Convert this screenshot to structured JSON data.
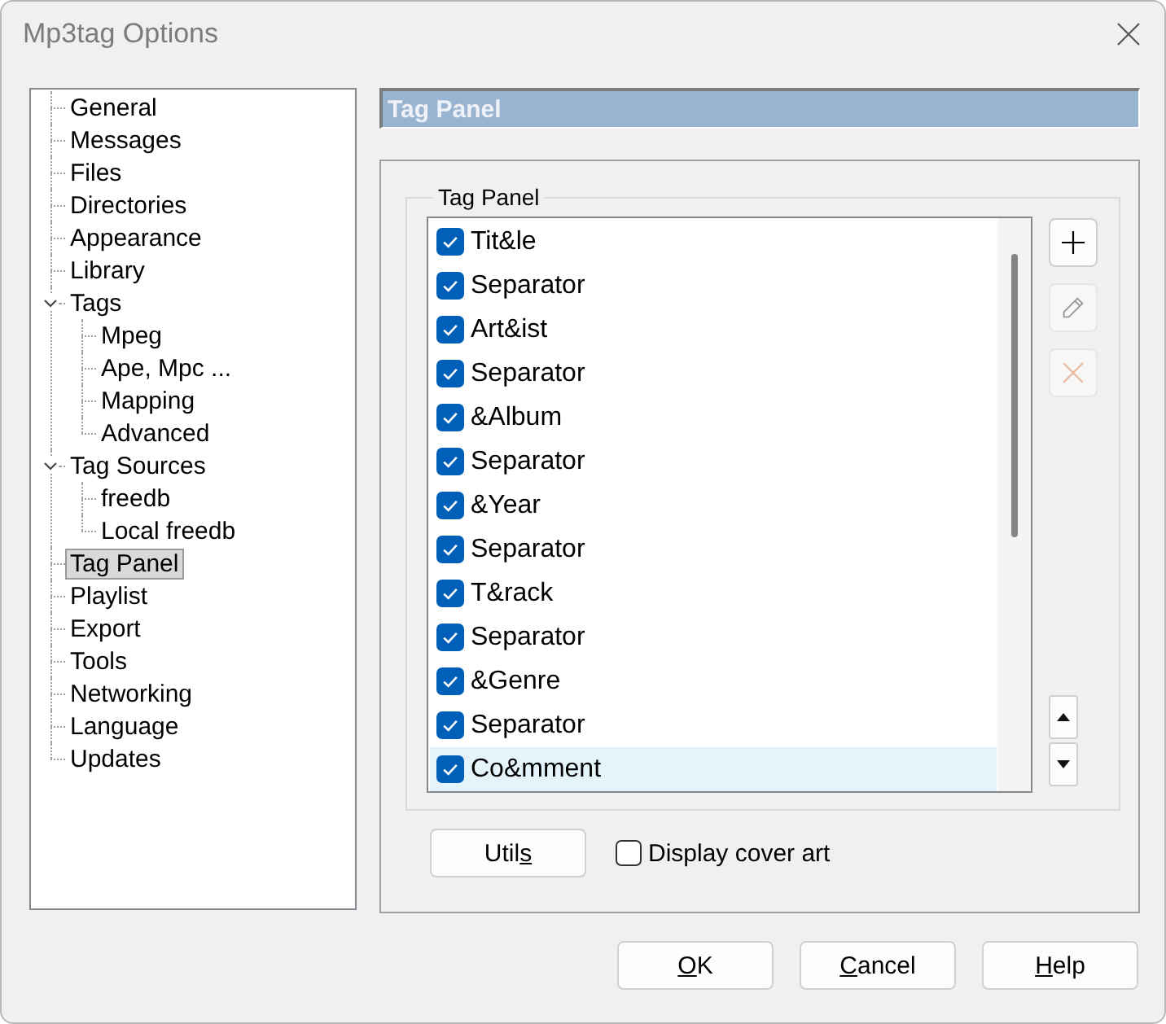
{
  "window": {
    "title": "Mp3tag Options"
  },
  "tree": [
    {
      "label": "General",
      "selected": false
    },
    {
      "label": "Messages",
      "selected": false
    },
    {
      "label": "Files",
      "selected": false
    },
    {
      "label": "Directories",
      "selected": false
    },
    {
      "label": "Appearance",
      "selected": false
    },
    {
      "label": "Library",
      "selected": false
    },
    {
      "label": "Tags",
      "selected": false,
      "expanded": true,
      "children": [
        {
          "label": "Mpeg",
          "selected": false
        },
        {
          "label": "Ape, Mpc ...",
          "selected": false
        },
        {
          "label": "Mapping",
          "selected": false
        },
        {
          "label": "Advanced",
          "selected": false
        }
      ]
    },
    {
      "label": "Tag Sources",
      "selected": false,
      "expanded": true,
      "children": [
        {
          "label": "freedb",
          "selected": false
        },
        {
          "label": "Local freedb",
          "selected": false
        }
      ]
    },
    {
      "label": "Tag Panel",
      "selected": true
    },
    {
      "label": "Playlist",
      "selected": false
    },
    {
      "label": "Export",
      "selected": false
    },
    {
      "label": "Tools",
      "selected": false
    },
    {
      "label": "Networking",
      "selected": false
    },
    {
      "label": "Language",
      "selected": false
    },
    {
      "label": "Updates",
      "selected": false
    }
  ],
  "page_header": {
    "title": "Tag Panel"
  },
  "tag_panel": {
    "group_label": "Tag Panel",
    "items": [
      {
        "label": "Tit&le",
        "checked": true,
        "highlighted": false
      },
      {
        "label": "Separator",
        "checked": true,
        "highlighted": false
      },
      {
        "label": "Art&ist",
        "checked": true,
        "highlighted": false
      },
      {
        "label": "Separator",
        "checked": true,
        "highlighted": false
      },
      {
        "label": "&Album",
        "checked": true,
        "highlighted": false
      },
      {
        "label": "Separator",
        "checked": true,
        "highlighted": false
      },
      {
        "label": "&Year",
        "checked": true,
        "highlighted": false
      },
      {
        "label": "Separator",
        "checked": true,
        "highlighted": false
      },
      {
        "label": "T&rack",
        "checked": true,
        "highlighted": false
      },
      {
        "label": "Separator",
        "checked": true,
        "highlighted": false
      },
      {
        "label": "&Genre",
        "checked": true,
        "highlighted": false
      },
      {
        "label": "Separator",
        "checked": true,
        "highlighted": false
      },
      {
        "label": "Co&mment",
        "checked": true,
        "highlighted": true
      }
    ],
    "side_buttons": [
      {
        "kind": "add",
        "disabled": false
      },
      {
        "kind": "edit",
        "disabled": true
      },
      {
        "kind": "delete",
        "disabled": true
      }
    ],
    "move_buttons": [
      {
        "kind": "up",
        "disabled": false
      },
      {
        "kind": "down",
        "disabled": false
      }
    ]
  },
  "utils_button": {
    "label_parts": [
      {
        "text": "Util",
        "underlined": false
      },
      {
        "text": "s",
        "underlined": true
      }
    ]
  },
  "display_cover_art": {
    "label": "Display cover art",
    "checked": false
  },
  "dialog_buttons": [
    {
      "label_parts": [
        {
          "text": "O",
          "underlined": true
        },
        {
          "text": "K",
          "underlined": false
        }
      ]
    },
    {
      "label_parts": [
        {
          "text": "C",
          "underlined": true
        },
        {
          "text": "ancel",
          "underlined": false
        }
      ]
    },
    {
      "label_parts": [
        {
          "text": "H",
          "underlined": true
        },
        {
          "text": "elp",
          "underlined": false
        }
      ]
    }
  ]
}
